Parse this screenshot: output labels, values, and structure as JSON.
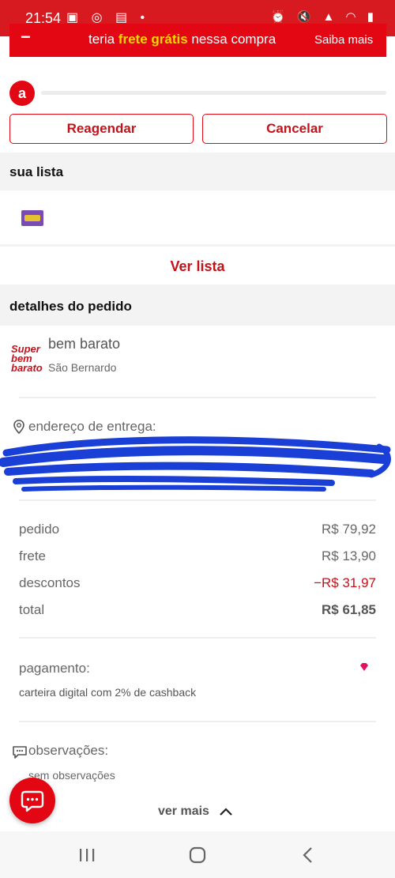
{
  "status_bar": {
    "time": "21:54",
    "left_icons": "▣ ◎ ▤ •",
    "right_icons": "⏰ 🔇 ▲ ◠ ▮"
  },
  "promo": {
    "prefix": "teria ",
    "highlight": "frete grátis",
    "suffix": " nessa compra",
    "link": "Saiba mais"
  },
  "progress": {
    "logo_letter": "a",
    "value": 0
  },
  "actions": {
    "reschedule": "Reagendar",
    "cancel": "Cancelar"
  },
  "list_section": {
    "title": "sua lista",
    "view_list": "Ver lista"
  },
  "order": {
    "title": "detalhes do pedido",
    "store": {
      "logo_text": "Super bem barato",
      "name": "bem barato",
      "city": "São Bernardo"
    },
    "address_label": "endereço de entrega:",
    "summary": [
      {
        "label": "pedido",
        "value": "R$ 79,92"
      },
      {
        "label": "frete",
        "value": "R$ 13,90"
      },
      {
        "label": "descontos",
        "value": "−R$ 31,97"
      },
      {
        "label": "total",
        "value": "R$ 61,85"
      }
    ],
    "payment": {
      "label": "pagamento:",
      "text": "carteira digital com 2% de cashback"
    },
    "notes": {
      "label": "observações:",
      "text": "sem observações"
    },
    "see_more": "ver mais"
  },
  "colors": {
    "brand_red": "#e30613",
    "highlight_yellow": "#ffd400",
    "redaction_blue": "#1a3fd6"
  }
}
